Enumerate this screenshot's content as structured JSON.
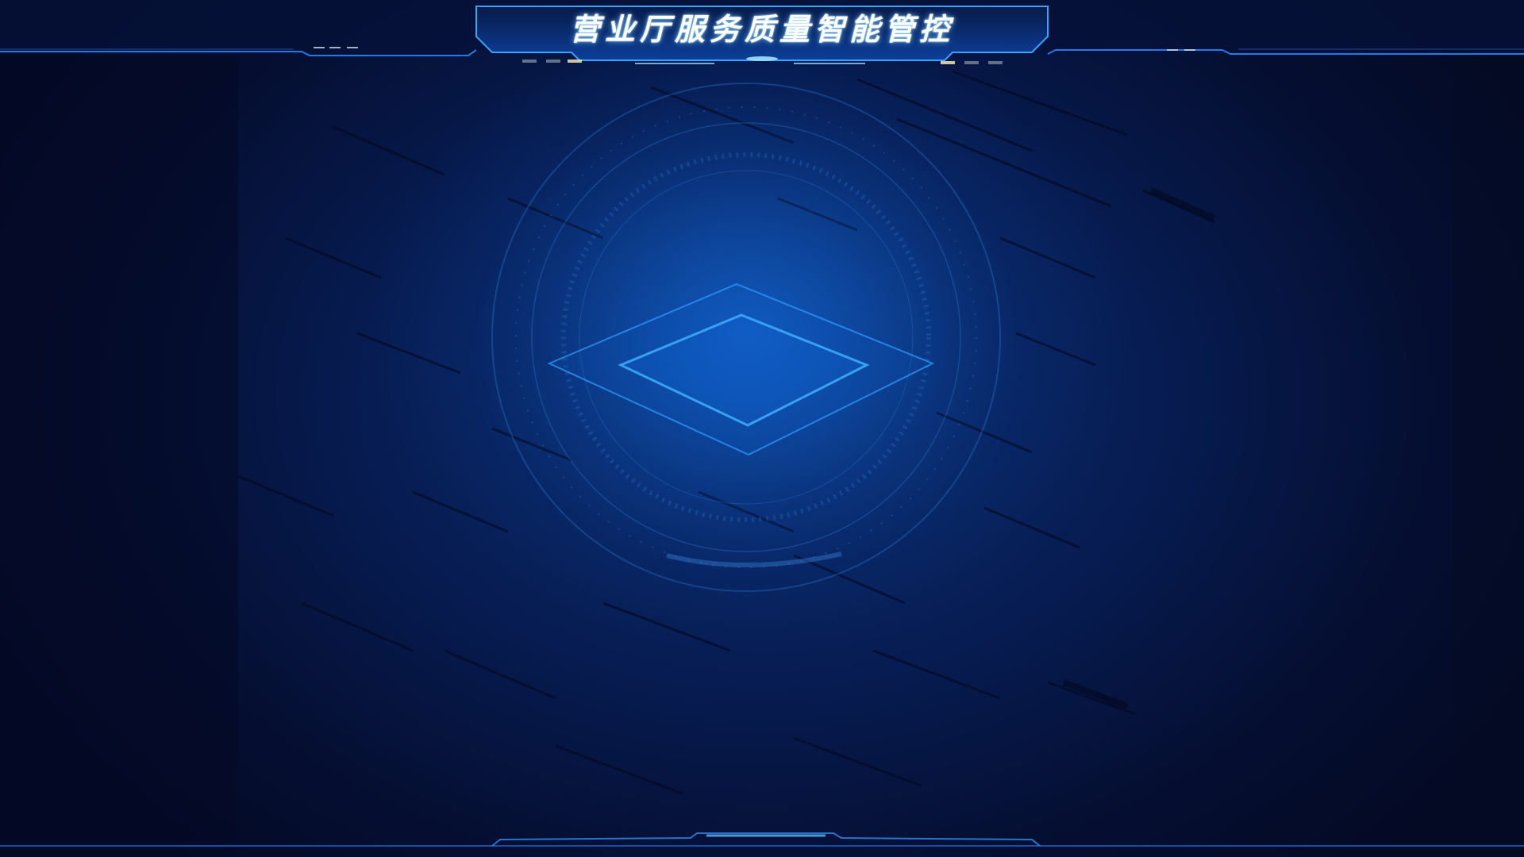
{
  "header": {
    "title": "营业厅服务质量智能管控"
  },
  "colors": {
    "background": "#050d2a",
    "accent": "#1e88ff",
    "glow": "#4fb4ff",
    "title_text": "#ffffff"
  }
}
